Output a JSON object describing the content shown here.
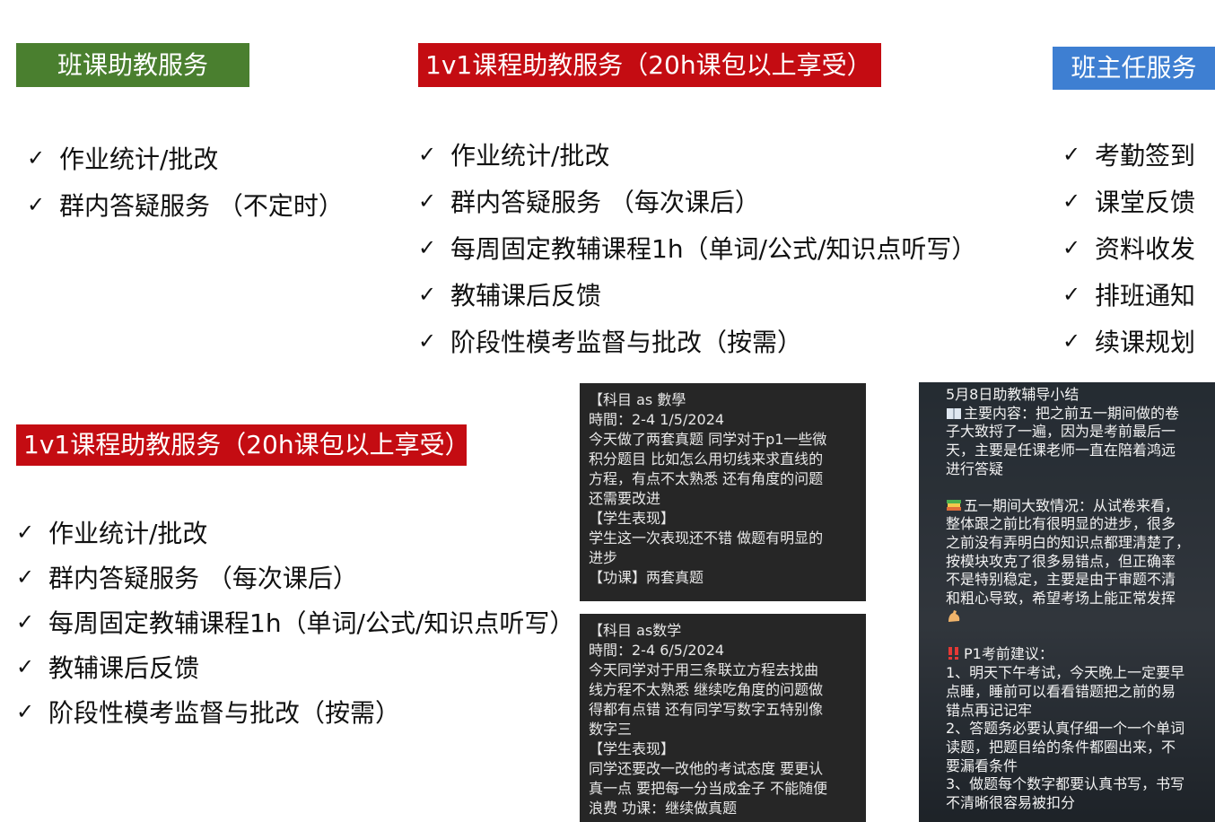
{
  "headers": {
    "group_ta": "班课助教服务",
    "one_on_one_top": "1v1课程助教服务（20h课包以上享受）",
    "class_teacher": "班主任服务",
    "one_on_one_bottom": "1v1课程助教服务（20h课包以上享受）"
  },
  "check_glyph": "✓",
  "group_ta_items": [
    "作业统计/批改",
    "群内答疑服务 （不定时）"
  ],
  "one_on_one_top_items": [
    "作业统计/批改",
    "群内答疑服务 （每次课后）",
    "每周固定教辅课程1h（单词/公式/知识点听写）",
    "教辅课后反馈",
    "阶段性模考监督与批改（按需）"
  ],
  "class_teacher_items": [
    "考勤签到",
    "课堂反馈",
    "资料收发",
    "排班通知",
    "续课规划"
  ],
  "one_on_one_bottom_items": [
    "作业统计/批改",
    "群内答疑服务 （每次课后）",
    "每周固定教辅课程1h（单词/公式/知识点听写）",
    "教辅课后反馈",
    "阶段性模考监督与批改（按需）"
  ],
  "chat_1": [
    "【科目 as 數學",
    "時間：2-4 1/5/2024",
    "今天做了两套真题 同学对于p1一些微",
    "积分题目 比如怎么用切线来求直线的",
    "方程，有点不太熟悉 还有角度的问题",
    "还需要改进",
    "【学生表现】",
    "学生这一次表现还不错 做题有明显的",
    "进步",
    "【功课】两套真题"
  ],
  "chat_2": [
    "【科目 as数学",
    "時間：2-4 6/5/2024",
    " 今天同学对于用三条联立方程去找曲",
    "线方程不太熟悉 继续吃角度的问题做",
    "得都有点错 还有同学写数字五特别像",
    "数字三",
    "【学生表现】",
    "同学还要改一改他的考试态度 要更认",
    "真一点 要把每一分当成金子 不能随便",
    "浪费 功课：继续做真题"
  ],
  "summary": {
    "title": "5月8日助教辅导小结",
    "main_content": [
      "主要内容：把之前五一期间做的卷",
      "子大致捋了一遍，因为是考前最后一",
      "天，主要是任课老师一直在陪着鸿远",
      "进行答疑"
    ],
    "may_day": [
      "五一期间大致情况：从试卷来看，",
      "整体跟之前比有很明显的进步，很多",
      "之前没有弄明白的知识点都理清楚了，",
      "按模块攻克了很多易错点，但正确率",
      "不是特别稳定，主要是由于审题不清",
      "和粗心导致，希望考场上能正常发挥"
    ],
    "advice_title": "P1考前建议：",
    "advice": [
      "1、明天下午考试，今天晚上一定要早",
      "点睡，睡前可以看看错题把之前的易",
      "错点再记记牢",
      "2、答题务必要认真仔细一个一个单词",
      "读题，把题目给的条件都圈出来，不",
      "要漏看条件",
      "3、做题每个数字都要认真书写，书写",
      "不清晰很容易被扣分"
    ],
    "icons": [
      "book-icon",
      "books-icon",
      "flexed-biceps-icon",
      "double-exclamation-icon"
    ]
  }
}
